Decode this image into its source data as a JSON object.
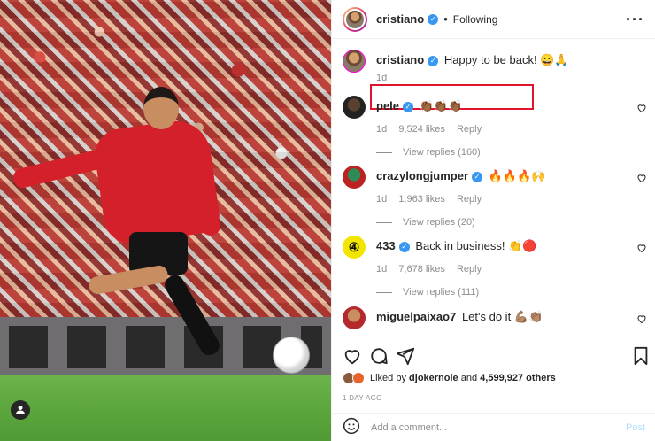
{
  "post": {
    "author": "cristiano",
    "follow_status": "Following",
    "more_icon": "more-horizontal-icon",
    "caption": "Happy to be back! 😀🙏",
    "caption_time": "1d"
  },
  "comments": [
    {
      "user": "pele",
      "text": "👏🏾👏🏾👏🏾",
      "time": "1d",
      "likes": "9,524 likes",
      "reply": "Reply",
      "view_replies": "View replies (160)"
    },
    {
      "user": "crazylongjumper",
      "text": "🔥🔥🔥🙌",
      "time": "1d",
      "likes": "1,963 likes",
      "reply": "Reply",
      "view_replies": "View replies (20)"
    },
    {
      "user": "433",
      "text": "Back in business! 👏🔴",
      "time": "1d",
      "likes": "7,678 likes",
      "reply": "Reply",
      "view_replies": "View replies (111)"
    },
    {
      "user": "miguelpaixao7",
      "text": "Let's do it 💪🏽👏🏽",
      "time": "1d",
      "likes": "",
      "reply": "",
      "view_replies": ""
    }
  ],
  "likes": {
    "prefix": "Liked by",
    "user": "djokernole",
    "conj": "and",
    "count": "4,599,927 others"
  },
  "date": "1 DAY AGO",
  "add_comment": {
    "placeholder": "Add a comment...",
    "post_label": "Post"
  },
  "colors": {
    "verified": "#3897f0",
    "highlight": "#e2142d",
    "post_disabled": "#b2dffc"
  }
}
